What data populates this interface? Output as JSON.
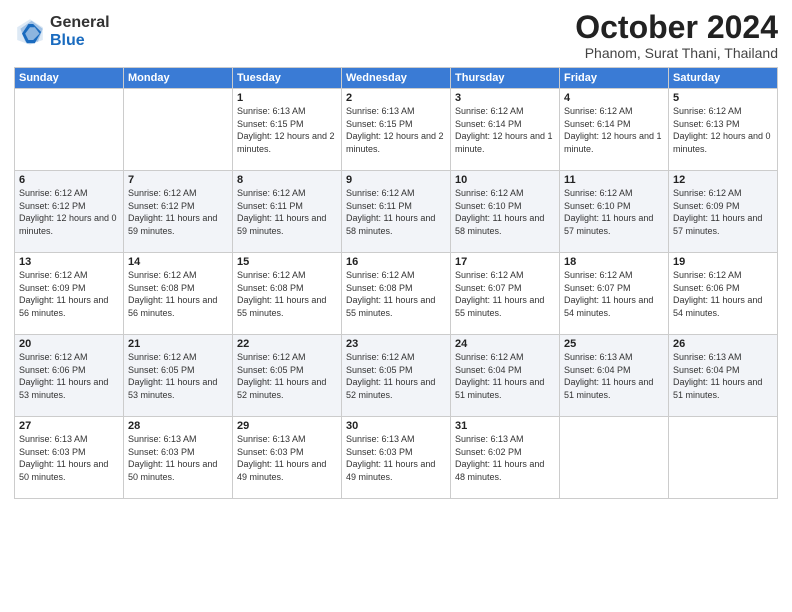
{
  "logo": {
    "general": "General",
    "blue": "Blue"
  },
  "title": "October 2024",
  "location": "Phanom, Surat Thani, Thailand",
  "days_of_week": [
    "Sunday",
    "Monday",
    "Tuesday",
    "Wednesday",
    "Thursday",
    "Friday",
    "Saturday"
  ],
  "weeks": [
    [
      {
        "day": "",
        "info": ""
      },
      {
        "day": "",
        "info": ""
      },
      {
        "day": "1",
        "info": "Sunrise: 6:13 AM\nSunset: 6:15 PM\nDaylight: 12 hours and 2 minutes."
      },
      {
        "day": "2",
        "info": "Sunrise: 6:13 AM\nSunset: 6:15 PM\nDaylight: 12 hours and 2 minutes."
      },
      {
        "day": "3",
        "info": "Sunrise: 6:12 AM\nSunset: 6:14 PM\nDaylight: 12 hours and 1 minute."
      },
      {
        "day": "4",
        "info": "Sunrise: 6:12 AM\nSunset: 6:14 PM\nDaylight: 12 hours and 1 minute."
      },
      {
        "day": "5",
        "info": "Sunrise: 6:12 AM\nSunset: 6:13 PM\nDaylight: 12 hours and 0 minutes."
      }
    ],
    [
      {
        "day": "6",
        "info": "Sunrise: 6:12 AM\nSunset: 6:12 PM\nDaylight: 12 hours and 0 minutes."
      },
      {
        "day": "7",
        "info": "Sunrise: 6:12 AM\nSunset: 6:12 PM\nDaylight: 11 hours and 59 minutes."
      },
      {
        "day": "8",
        "info": "Sunrise: 6:12 AM\nSunset: 6:11 PM\nDaylight: 11 hours and 59 minutes."
      },
      {
        "day": "9",
        "info": "Sunrise: 6:12 AM\nSunset: 6:11 PM\nDaylight: 11 hours and 58 minutes."
      },
      {
        "day": "10",
        "info": "Sunrise: 6:12 AM\nSunset: 6:10 PM\nDaylight: 11 hours and 58 minutes."
      },
      {
        "day": "11",
        "info": "Sunrise: 6:12 AM\nSunset: 6:10 PM\nDaylight: 11 hours and 57 minutes."
      },
      {
        "day": "12",
        "info": "Sunrise: 6:12 AM\nSunset: 6:09 PM\nDaylight: 11 hours and 57 minutes."
      }
    ],
    [
      {
        "day": "13",
        "info": "Sunrise: 6:12 AM\nSunset: 6:09 PM\nDaylight: 11 hours and 56 minutes."
      },
      {
        "day": "14",
        "info": "Sunrise: 6:12 AM\nSunset: 6:08 PM\nDaylight: 11 hours and 56 minutes."
      },
      {
        "day": "15",
        "info": "Sunrise: 6:12 AM\nSunset: 6:08 PM\nDaylight: 11 hours and 55 minutes."
      },
      {
        "day": "16",
        "info": "Sunrise: 6:12 AM\nSunset: 6:08 PM\nDaylight: 11 hours and 55 minutes."
      },
      {
        "day": "17",
        "info": "Sunrise: 6:12 AM\nSunset: 6:07 PM\nDaylight: 11 hours and 55 minutes."
      },
      {
        "day": "18",
        "info": "Sunrise: 6:12 AM\nSunset: 6:07 PM\nDaylight: 11 hours and 54 minutes."
      },
      {
        "day": "19",
        "info": "Sunrise: 6:12 AM\nSunset: 6:06 PM\nDaylight: 11 hours and 54 minutes."
      }
    ],
    [
      {
        "day": "20",
        "info": "Sunrise: 6:12 AM\nSunset: 6:06 PM\nDaylight: 11 hours and 53 minutes."
      },
      {
        "day": "21",
        "info": "Sunrise: 6:12 AM\nSunset: 6:05 PM\nDaylight: 11 hours and 53 minutes."
      },
      {
        "day": "22",
        "info": "Sunrise: 6:12 AM\nSunset: 6:05 PM\nDaylight: 11 hours and 52 minutes."
      },
      {
        "day": "23",
        "info": "Sunrise: 6:12 AM\nSunset: 6:05 PM\nDaylight: 11 hours and 52 minutes."
      },
      {
        "day": "24",
        "info": "Sunrise: 6:12 AM\nSunset: 6:04 PM\nDaylight: 11 hours and 51 minutes."
      },
      {
        "day": "25",
        "info": "Sunrise: 6:13 AM\nSunset: 6:04 PM\nDaylight: 11 hours and 51 minutes."
      },
      {
        "day": "26",
        "info": "Sunrise: 6:13 AM\nSunset: 6:04 PM\nDaylight: 11 hours and 51 minutes."
      }
    ],
    [
      {
        "day": "27",
        "info": "Sunrise: 6:13 AM\nSunset: 6:03 PM\nDaylight: 11 hours and 50 minutes."
      },
      {
        "day": "28",
        "info": "Sunrise: 6:13 AM\nSunset: 6:03 PM\nDaylight: 11 hours and 50 minutes."
      },
      {
        "day": "29",
        "info": "Sunrise: 6:13 AM\nSunset: 6:03 PM\nDaylight: 11 hours and 49 minutes."
      },
      {
        "day": "30",
        "info": "Sunrise: 6:13 AM\nSunset: 6:03 PM\nDaylight: 11 hours and 49 minutes."
      },
      {
        "day": "31",
        "info": "Sunrise: 6:13 AM\nSunset: 6:02 PM\nDaylight: 11 hours and 48 minutes."
      },
      {
        "day": "",
        "info": ""
      },
      {
        "day": "",
        "info": ""
      }
    ]
  ]
}
